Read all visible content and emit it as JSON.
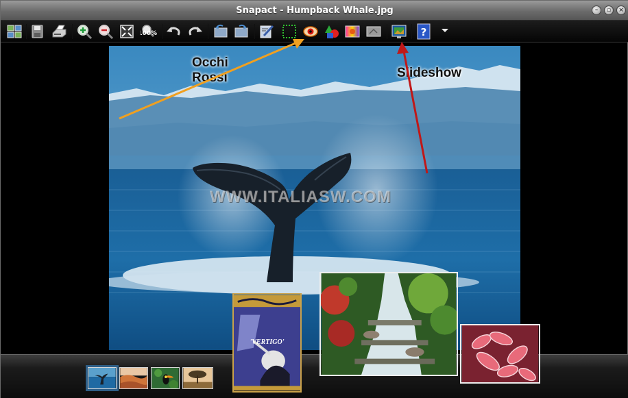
{
  "window": {
    "title": "Snapact - Humpback Whale.jpg"
  },
  "toolbar": {
    "items": [
      {
        "name": "browse-thumbnails",
        "icon": "thumbnails-icon"
      },
      {
        "name": "save",
        "icon": "save-icon"
      },
      {
        "name": "print",
        "icon": "printer-icon"
      },
      {
        "name": "zoom-in",
        "icon": "zoom-in-icon"
      },
      {
        "name": "zoom-out",
        "icon": "zoom-out-icon"
      },
      {
        "name": "fit-to-window",
        "icon": "fit-window-icon"
      },
      {
        "name": "actual-size",
        "icon": "actual-size-icon",
        "label": "100%"
      },
      {
        "name": "undo",
        "icon": "undo-icon"
      },
      {
        "name": "redo",
        "icon": "redo-icon"
      },
      {
        "name": "rotate-left",
        "icon": "rotate-left-icon"
      },
      {
        "name": "rotate-right",
        "icon": "rotate-right-icon"
      },
      {
        "name": "edit",
        "icon": "edit-icon"
      },
      {
        "name": "crop",
        "icon": "crop-icon"
      },
      {
        "name": "red-eye",
        "icon": "eye-icon"
      },
      {
        "name": "color-adjust",
        "icon": "color-shapes-icon"
      },
      {
        "name": "effects",
        "icon": "effects-icon"
      },
      {
        "name": "resize",
        "icon": "resize-icon"
      },
      {
        "name": "slideshow",
        "icon": "slideshow-icon"
      },
      {
        "name": "help",
        "icon": "help-icon",
        "label": "?"
      },
      {
        "name": "more",
        "icon": "dropdown-arrow-icon"
      }
    ]
  },
  "annotations": {
    "red_eye_label_line1": "Occhi",
    "red_eye_label_line2": "Rossi",
    "slideshow_label": "Slideshow",
    "arrow_color_orange": "#f0a020",
    "arrow_color_red": "#c01818"
  },
  "watermark": "WWW.ITALIASW.COM",
  "thumbnails": [
    {
      "name": "humpback-whale",
      "selected": true
    },
    {
      "name": "desert-dunes",
      "selected": false
    },
    {
      "name": "toucan",
      "selected": false
    },
    {
      "name": "tree-sunset",
      "selected": false
    }
  ],
  "popups": {
    "movie": {
      "title": "'VERTIGO'"
    }
  }
}
